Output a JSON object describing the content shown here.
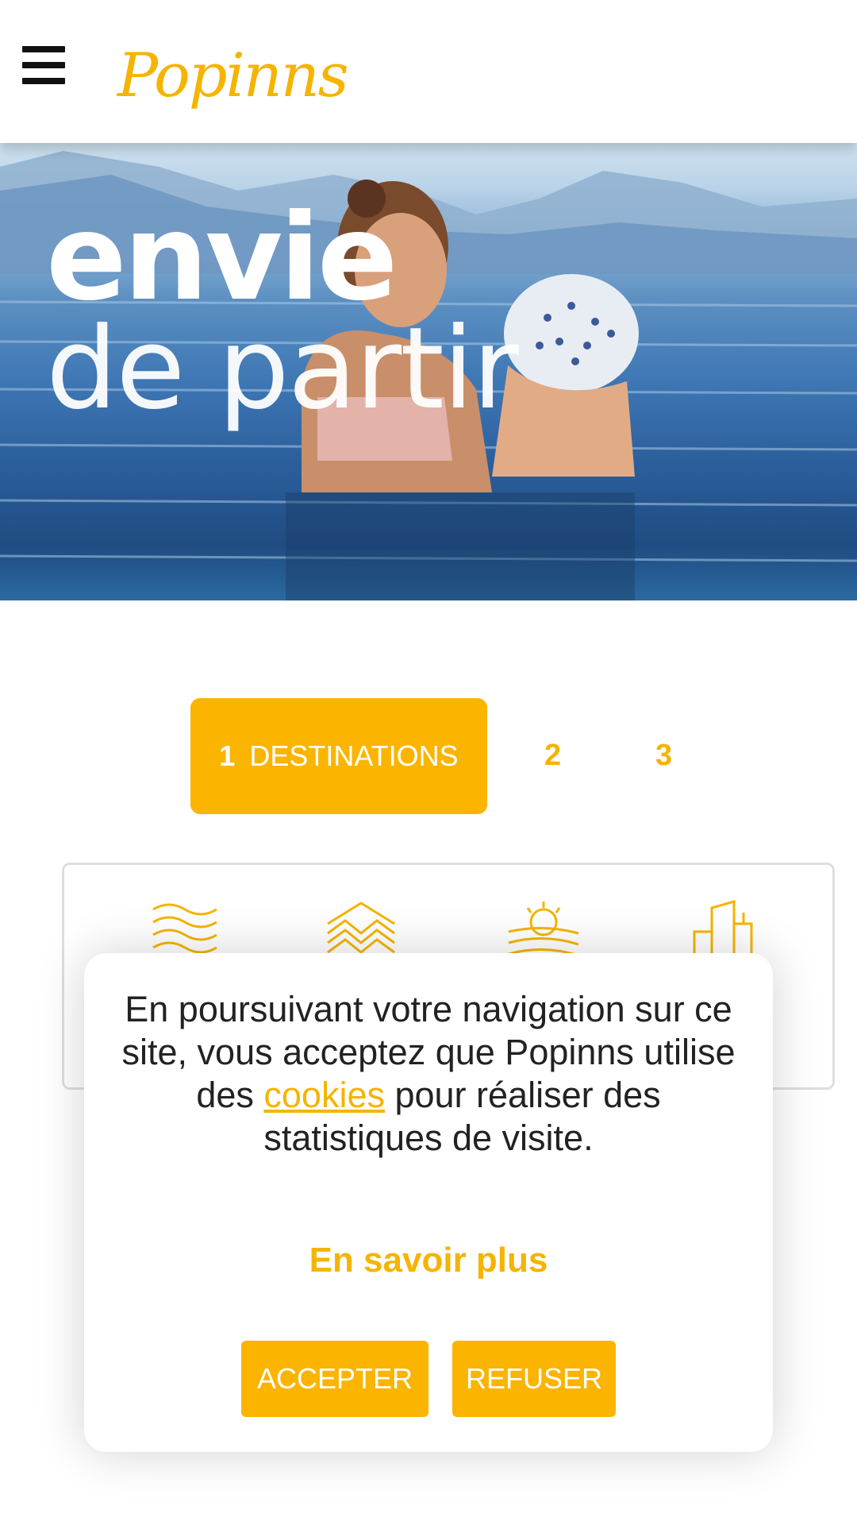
{
  "header": {
    "menu_icon": "hamburger-menu-icon",
    "logo_text": "Popinns"
  },
  "hero": {
    "line1": "envie",
    "line2": "de partir"
  },
  "steps": [
    {
      "number": "1",
      "label": "DESTINATIONS",
      "active": true
    },
    {
      "number": "2",
      "label": "",
      "active": false
    },
    {
      "number": "3",
      "label": "",
      "active": false
    }
  ],
  "destinations": {
    "icons": [
      "sea-waves-icon",
      "mountain-icon",
      "countryside-icon",
      "city-icon"
    ]
  },
  "cookie_banner": {
    "text_before": "En poursuivant votre navigation sur ce site, vous acceptez que Popinns utilise des ",
    "link_text": "cookies",
    "text_after": " pour réaliser des statistiques de visite.",
    "more_label": "En savoir plus",
    "accept_label": "ACCEPTER",
    "refuse_label": "REFUSER"
  },
  "colors": {
    "accent": "#fbb400",
    "accent_text": "#f5b400",
    "text": "#222222"
  }
}
